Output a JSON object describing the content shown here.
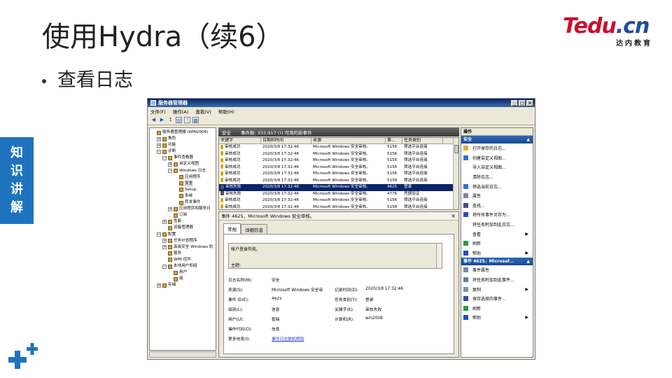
{
  "slide": {
    "title": "使用Hydra（续6）",
    "bullet": "查看日志",
    "side_tag": [
      "知",
      "识",
      "讲",
      "解"
    ],
    "logo": {
      "main_red": "Tedu",
      "main_blue": ".cn",
      "sub": "达内教育"
    }
  },
  "window": {
    "title": "服务器管理器",
    "controls": [
      "_",
      "□",
      "×"
    ],
    "menu": [
      "文件(F)",
      "操作(A)",
      "查看(V)",
      "帮助(H)"
    ],
    "toolbar_icons": [
      "back-icon",
      "forward-icon",
      "up-icon",
      "show-hide-icon",
      "help-icon",
      "properties-icon"
    ],
    "tree": [
      {
        "label": "服务器管理器 (WIN2008)",
        "level": 0,
        "toggle": ""
      },
      {
        "label": "角色",
        "level": 1,
        "toggle": "+"
      },
      {
        "label": "功能",
        "level": 1,
        "toggle": "+"
      },
      {
        "label": "诊断",
        "level": 1,
        "toggle": "−"
      },
      {
        "label": "事件查看器",
        "level": 2,
        "toggle": "−"
      },
      {
        "label": "自定义视图",
        "level": 3,
        "toggle": "+"
      },
      {
        "label": "Windows 日志",
        "level": 3,
        "toggle": "−"
      },
      {
        "label": "应用程序",
        "level": 4,
        "toggle": ""
      },
      {
        "label": "安全",
        "level": 4,
        "toggle": "",
        "selected": true
      },
      {
        "label": "Setup",
        "level": 4,
        "toggle": ""
      },
      {
        "label": "系统",
        "level": 4,
        "toggle": ""
      },
      {
        "label": "转发事件",
        "level": 4,
        "toggle": ""
      },
      {
        "label": "应用程序和服务日",
        "level": 3,
        "toggle": "+"
      },
      {
        "label": "订阅",
        "level": 3,
        "toggle": ""
      },
      {
        "label": "性能",
        "level": 2,
        "toggle": "+"
      },
      {
        "label": "设备管理器",
        "level": 2,
        "toggle": ""
      },
      {
        "label": "配置",
        "level": 1,
        "toggle": "−"
      },
      {
        "label": "任务计划程序",
        "level": 2,
        "toggle": "+"
      },
      {
        "label": "高级安全 Windows 防",
        "level": 2,
        "toggle": "+"
      },
      {
        "label": "服务",
        "level": 2,
        "toggle": ""
      },
      {
        "label": "WMI 控件",
        "level": 2,
        "toggle": ""
      },
      {
        "label": "本地用户和组",
        "level": 2,
        "toggle": "−"
      },
      {
        "label": "用户",
        "level": 3,
        "toggle": ""
      },
      {
        "label": "组",
        "level": 3,
        "toggle": ""
      },
      {
        "label": "存储",
        "level": 1,
        "toggle": "+"
      }
    ],
    "log_header": {
      "name": "安全",
      "count": "事件数: 333,917 (!) 可用的新事件"
    },
    "columns": [
      "关键字",
      "日期和时间",
      "来源",
      "事...",
      "任务类别"
    ],
    "rows": [
      {
        "kw": "审核成功",
        "dt": "2020/3/8 17:32:46",
        "src": "Microsoft Windows 安全审核。",
        "id": "5156",
        "cat": "筛选平台连接",
        "icon": "key-icon"
      },
      {
        "kw": "审核成功",
        "dt": "2020/3/8 17:32:46",
        "src": "Microsoft Windows 安全审核。",
        "id": "5156",
        "cat": "筛选平台连接",
        "icon": "key-icon"
      },
      {
        "kw": "审核成功",
        "dt": "2020/3/8 17:32:46",
        "src": "Microsoft Windows 安全审核。",
        "id": "5158",
        "cat": "筛选平台连接",
        "icon": "key-icon"
      },
      {
        "kw": "审核成功",
        "dt": "2020/3/8 17:32:46",
        "src": "Microsoft Windows 安全审核。",
        "id": "5156",
        "cat": "筛选平台连接",
        "icon": "key-icon"
      },
      {
        "kw": "审核成功",
        "dt": "2020/3/8 17:32:46",
        "src": "Microsoft Windows 安全审核。",
        "id": "5156",
        "cat": "筛选平台连接",
        "icon": "key-icon"
      },
      {
        "kw": "审核成功",
        "dt": "2020/3/8 17:32:46",
        "src": "Microsoft Windows 安全审核。",
        "id": "5158",
        "cat": "筛选平台连接",
        "icon": "key-icon"
      },
      {
        "kw": "审核失败",
        "dt": "2020/3/8 17:32:46",
        "src": "Microsoft Windows 安全审核。",
        "id": "4625",
        "cat": "登录",
        "icon": "lock-icon",
        "selected": true
      },
      {
        "kw": "审核失败",
        "dt": "2020/3/8 17:32:46",
        "src": "Microsoft Windows 安全审核。",
        "id": "4776",
        "cat": "凭据验证",
        "icon": "lock-icon"
      },
      {
        "kw": "审核成功",
        "dt": "2020/3/8 17:32:46",
        "src": "Microsoft Windows 安全审核。",
        "id": "5156",
        "cat": "筛选平台连接",
        "icon": "key-icon"
      },
      {
        "kw": "审核成功",
        "dt": "2020/3/8 17:32:46",
        "src": "Microsoft Windows 安全审核。",
        "id": "5158",
        "cat": "筛选平台连接",
        "icon": "key-icon"
      }
    ],
    "detail": {
      "title": "事件 4625，Microsoft Windows 安全审核。",
      "tabs": [
        "常规",
        "详细信息"
      ],
      "description_line1": "帐户登录失败。",
      "description_line2": "主题:",
      "fields": [
        {
          "l": "日志名称(M):",
          "v": "安全",
          "l2": "",
          "v2": ""
        },
        {
          "l": "来源(S):",
          "v": "Microsoft Windows 安全审",
          "l2": "记录时间(D):",
          "v2": "2020/3/8 17:32:46"
        },
        {
          "l": "事件 ID(E):",
          "v": "4625",
          "l2": "任务类别(Y):",
          "v2": "登录"
        },
        {
          "l": "级别(L):",
          "v": "信息",
          "l2": "关键字(K):",
          "v2": "审核失败"
        },
        {
          "l": "用户(U):",
          "v": "暂缺",
          "l2": "计算机(R):",
          "v2": "win2008"
        },
        {
          "l": "操作代码(O):",
          "v": "信息",
          "l2": "",
          "v2": ""
        }
      ],
      "more_info_label": "更多信息(I):",
      "more_info_link": "事件日志联机帮助"
    },
    "actions": {
      "header": "操作",
      "section1": "安全",
      "items1": [
        {
          "label": "打开保存的日志...",
          "icon": "open-folder-icon",
          "arrow": false
        },
        {
          "label": "创建自定义视图...",
          "icon": "filter-icon",
          "arrow": false
        },
        {
          "label": "导入自定义视图...",
          "icon": "",
          "arrow": false
        },
        {
          "label": "清除日志...",
          "icon": "",
          "arrow": false
        },
        {
          "label": "筛选当前日志...",
          "icon": "filter-icon",
          "arrow": false
        },
        {
          "label": "属性",
          "icon": "properties-icon",
          "arrow": false
        },
        {
          "label": "查找...",
          "icon": "find-icon",
          "arrow": false
        },
        {
          "label": "将所有事件另存为...",
          "icon": "save-icon",
          "arrow": false
        },
        {
          "label": "将任务附加到此日志...",
          "icon": "",
          "arrow": false
        },
        {
          "label": "查看",
          "icon": "",
          "arrow": true
        },
        {
          "label": "刷新",
          "icon": "refresh-icon",
          "arrow": false
        },
        {
          "label": "帮助",
          "icon": "help-icon",
          "arrow": true
        }
      ],
      "section2": "事件 4625，Microsof...",
      "items2": [
        {
          "label": "事件属性",
          "icon": "properties-icon",
          "arrow": false
        },
        {
          "label": "将任务附加到此事件...",
          "icon": "task-icon",
          "arrow": false
        },
        {
          "label": "复制",
          "icon": "copy-icon",
          "arrow": true
        },
        {
          "label": "保存选择的事件...",
          "icon": "save-icon",
          "arrow": false
        },
        {
          "label": "刷新",
          "icon": "refresh-icon",
          "arrow": false
        },
        {
          "label": "帮助",
          "icon": "help-icon",
          "arrow": true
        }
      ]
    }
  }
}
